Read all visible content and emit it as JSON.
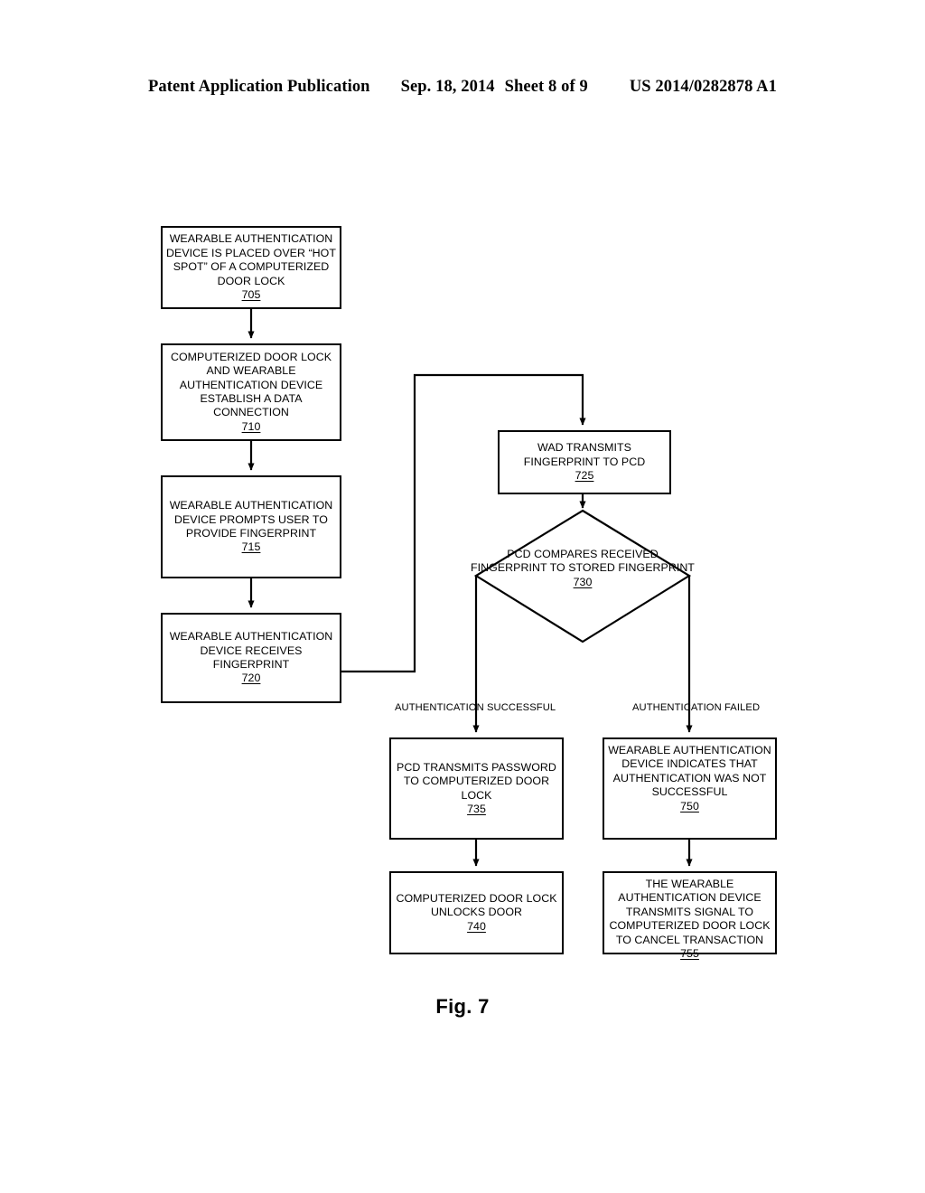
{
  "header": {
    "publication": "Patent Application Publication",
    "date": "Sep. 18, 2014",
    "sheet": "Sheet 8 of 9",
    "number": "US 2014/0282878 A1"
  },
  "figure": {
    "caption": "Fig. 7",
    "nodes": [
      {
        "id": "705",
        "shape": "process",
        "text": "WEARABLE AUTHENTICATION DEVICE IS PLACED OVER “HOT SPOT” OF A COMPUTERIZED DOOR LOCK",
        "ref": "705"
      },
      {
        "id": "710",
        "shape": "process",
        "text": "COMPUTERIZED DOOR LOCK AND WEARABLE AUTHENTICATION DEVICE ESTABLISH A DATA CONNECTION",
        "ref": "710"
      },
      {
        "id": "715",
        "shape": "process",
        "text": "WEARABLE AUTHENTICATION DEVICE PROMPTS USER TO PROVIDE FINGERPRINT",
        "ref": "715"
      },
      {
        "id": "720",
        "shape": "process",
        "text": "WEARABLE AUTHENTICATION DEVICE RECEIVES FINGERPRINT",
        "ref": "720"
      },
      {
        "id": "725",
        "shape": "process",
        "text": "WAD TRANSMITS FINGERPRINT TO PCD",
        "ref": "725"
      },
      {
        "id": "730",
        "shape": "decision",
        "text": "PCD COMPARES RECEIVED FINGERPRINT TO STORED FINGERPRINT",
        "ref": "730"
      },
      {
        "id": "735",
        "shape": "process",
        "text": "PCD TRANSMITS PASSWORD TO COMPUTERIZED DOOR LOCK",
        "ref": "735"
      },
      {
        "id": "740",
        "shape": "process",
        "text": "COMPUTERIZED DOOR LOCK UNLOCKS DOOR",
        "ref": "740"
      },
      {
        "id": "750",
        "shape": "process",
        "text": "WEARABLE AUTHENTICATION DEVICE INDICATES THAT AUTHENTICATION WAS NOT SUCCESSFUL",
        "ref": "750"
      },
      {
        "id": "755",
        "shape": "process",
        "text": "THE WEARABLE AUTHENTICATION DEVICE TRANSMITS SIGNAL TO COMPUTERIZED DOOR LOCK TO CANCEL TRANSACTION",
        "ref": "755"
      }
    ],
    "edge_labels": {
      "success": "AUTHENTICATION SUCCESSFUL",
      "failure": "AUTHENTICATION FAILED"
    }
  },
  "colors": {
    "ink": "#000000",
    "paper": "#ffffff"
  }
}
